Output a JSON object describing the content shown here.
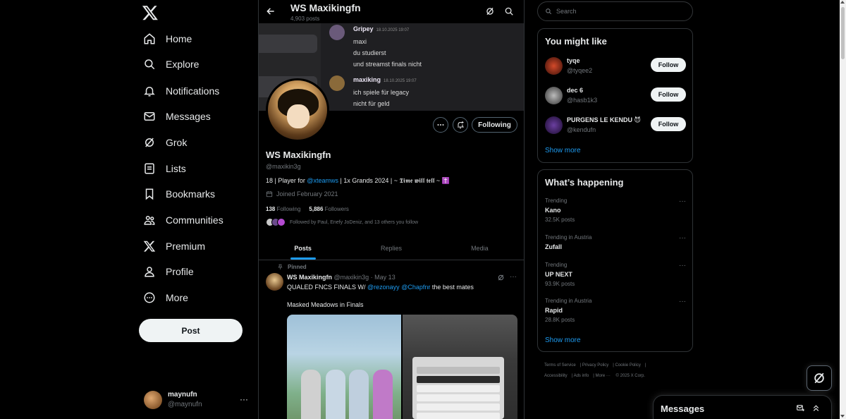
{
  "nav": {
    "items": [
      {
        "label": "Home",
        "icon": "home-icon"
      },
      {
        "label": "Explore",
        "icon": "search-icon"
      },
      {
        "label": "Notifications",
        "icon": "bell-icon"
      },
      {
        "label": "Messages",
        "icon": "envelope-icon"
      },
      {
        "label": "Grok",
        "icon": "grok-icon"
      },
      {
        "label": "Lists",
        "icon": "list-icon"
      },
      {
        "label": "Bookmarks",
        "icon": "bookmark-icon"
      },
      {
        "label": "Communities",
        "icon": "people-icon"
      },
      {
        "label": "Premium",
        "icon": "x-icon"
      },
      {
        "label": "Profile",
        "icon": "person-icon"
      },
      {
        "label": "More",
        "icon": "more-circle-icon"
      }
    ],
    "post_label": "Post",
    "account": {
      "name": "maynufn",
      "handle": "@maynufn"
    }
  },
  "header": {
    "title": "WS Maxikingfn",
    "post_count": "4,903 posts"
  },
  "banner_chat": [
    {
      "name": "Gripey",
      "time": "18.10.2025 19:07",
      "lines": [
        "maxi",
        "du studierst",
        "und streamst finals nicht"
      ]
    },
    {
      "name": "maxiking",
      "time": "18.10.2025 19:07",
      "lines": [
        "ich spiele für legacy",
        "nicht für geld"
      ]
    }
  ],
  "profile": {
    "name": "WS Maxikingfn",
    "handle": "@maxikin3g",
    "bio_pre": "18 | Player for ",
    "bio_link": "@xteamws",
    "bio_post": " | 1x Grands 2024 | ~ 𝕿𝖎𝖒𝖊 𝖜𝖎𝖑𝖑 𝖙𝖊𝖑𝖑 ~ ✝️",
    "joined": "Joined February 2021",
    "following_count": "138",
    "following_label": "Following",
    "followers_count": "5,886",
    "followers_label": "Followers",
    "followed_by": "Followed by Paul, Enefy JoDeniz, and 13 others you follow",
    "following_button": "Following"
  },
  "tabs": [
    "Posts",
    "Replies",
    "Media"
  ],
  "post": {
    "pinned_label": "Pinned",
    "author": "WS Maxikingfn",
    "meta": "@maxikin3g · May 13",
    "text_pre": "QUALED FNCS FINALS W/ ",
    "mention1": "@rezonayy",
    "mention2": "@Chapfnr",
    "text_post": " the best mates",
    "text2": "Masked Meadows in Finals"
  },
  "search": {
    "placeholder": "Search"
  },
  "suggestions": {
    "title": "You might like",
    "users": [
      {
        "name": "tyqe",
        "handle": "@tyqee2",
        "button": "Follow"
      },
      {
        "name": "dec 6",
        "handle": "@hasb1k3",
        "button": "Follow"
      },
      {
        "name": "PURGENS LE KENDU 😈",
        "handle": "@kendufn",
        "button": "Follow"
      }
    ],
    "show_more": "Show more"
  },
  "trends": {
    "title": "What’s happening",
    "items": [
      {
        "category": "Trending",
        "name": "Kano",
        "posts": "32.5K posts"
      },
      {
        "category": "Trending in Austria",
        "name": "Zufall",
        "posts": ""
      },
      {
        "category": "Trending",
        "name": "UP NEXT",
        "posts": "93.9K posts"
      },
      {
        "category": "Trending in Austria",
        "name": "Rapid",
        "posts": "28.8K posts"
      }
    ],
    "show_more": "Show more"
  },
  "footer": {
    "links": [
      "Terms of Service",
      "Privacy Policy",
      "Cookie Policy",
      "Accessibility",
      "Ads info",
      "More ···"
    ],
    "copyright": "© 2025 X Corp."
  },
  "messages_drawer": {
    "title": "Messages"
  },
  "colors": {
    "accent": "#1d9bf0",
    "background": "#000000",
    "border": "#2f3336",
    "muted": "#71767b"
  }
}
